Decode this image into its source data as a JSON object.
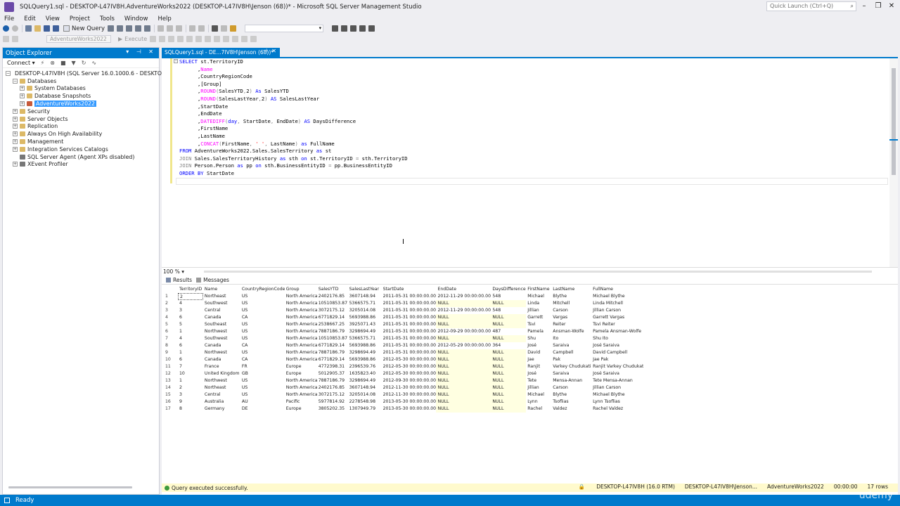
{
  "window": {
    "title": "SQLQuery1.sql - DESKTOP-L47IV8H.AdventureWorks2022 (DESKTOP-L47IV8H\\Jenson (68))* - Microsoft SQL Server Management Studio",
    "quick_launch_placeholder": "Quick Launch (Ctrl+Q)"
  },
  "menu": [
    "File",
    "Edit",
    "View",
    "Project",
    "Tools",
    "Window",
    "Help"
  ],
  "toolbar": {
    "new_query_label": "New Query",
    "database_combo_value": "AdventureWorks2022",
    "execute_label": "Execute"
  },
  "object_explorer": {
    "title": "Object Explorer",
    "connect_label": "Connect",
    "tree": {
      "server": "DESKTOP-L47IV8H (SQL Server 16.0.1000.6 - DESKTOP-L47I",
      "databases": "Databases",
      "system_databases": "System Databases",
      "database_snapshots": "Database Snapshots",
      "adventureworks": "AdventureWorks2022",
      "security": "Security",
      "server_objects": "Server Objects",
      "replication": "Replication",
      "always_on": "Always On High Availability",
      "management": "Management",
      "integration_services": "Integration Services Catalogs",
      "sql_agent": "SQL Server Agent (Agent XPs disabled)",
      "xevent": "XEvent Profiler"
    }
  },
  "document_tab": {
    "label": "SQLQuery1.sql - DE...7IV8H\\Jenson (68))*"
  },
  "editor": {
    "zoom": "100 %",
    "lines": [
      [
        {
          "t": "kw",
          "v": "SELECT"
        },
        {
          "t": "tx",
          "v": " st.TerritoryID"
        }
      ],
      [
        {
          "t": "tx",
          "v": "      ,"
        },
        {
          "t": "fn",
          "v": "Name"
        }
      ],
      [
        {
          "t": "tx",
          "v": "      ,CountryRegionCode"
        }
      ],
      [
        {
          "t": "tx",
          "v": "      ,[Group]"
        }
      ],
      [
        {
          "t": "tx",
          "v": "      ,"
        },
        {
          "t": "fn",
          "v": "ROUND"
        },
        {
          "t": "gr",
          "v": "("
        },
        {
          "t": "tx",
          "v": "SalesYTD"
        },
        {
          "t": "gr",
          "v": ","
        },
        {
          "t": "tx",
          "v": "2"
        },
        {
          "t": "gr",
          "v": ")"
        },
        {
          "t": "tx",
          "v": " "
        },
        {
          "t": "kw",
          "v": "As"
        },
        {
          "t": "tx",
          "v": " SalesYTD"
        }
      ],
      [
        {
          "t": "tx",
          "v": "      ,"
        },
        {
          "t": "fn",
          "v": "ROUND"
        },
        {
          "t": "gr",
          "v": "("
        },
        {
          "t": "tx",
          "v": "SalesLastYear"
        },
        {
          "t": "gr",
          "v": ","
        },
        {
          "t": "tx",
          "v": "2"
        },
        {
          "t": "gr",
          "v": ")"
        },
        {
          "t": "tx",
          "v": " "
        },
        {
          "t": "kw",
          "v": "AS"
        },
        {
          "t": "tx",
          "v": " SalesLastYear"
        }
      ],
      [
        {
          "t": "tx",
          "v": "      ,StartDate"
        }
      ],
      [
        {
          "t": "tx",
          "v": "      ,EndDate"
        }
      ],
      [
        {
          "t": "tx",
          "v": "      ,"
        },
        {
          "t": "fn",
          "v": "DATEDIFF"
        },
        {
          "t": "gr",
          "v": "("
        },
        {
          "t": "kw",
          "v": "day"
        },
        {
          "t": "gr",
          "v": ","
        },
        {
          "t": "tx",
          "v": " StartDate"
        },
        {
          "t": "gr",
          "v": ","
        },
        {
          "t": "tx",
          "v": " EndDate"
        },
        {
          "t": "gr",
          "v": ")"
        },
        {
          "t": "tx",
          "v": " "
        },
        {
          "t": "kw",
          "v": "AS"
        },
        {
          "t": "tx",
          "v": " DaysDifference"
        }
      ],
      [
        {
          "t": "tx",
          "v": "      ,FirstName"
        }
      ],
      [
        {
          "t": "tx",
          "v": "      ,LastName"
        }
      ],
      [
        {
          "t": "tx",
          "v": "      ,"
        },
        {
          "t": "fn",
          "v": "CONCAT"
        },
        {
          "t": "gr",
          "v": "("
        },
        {
          "t": "tx",
          "v": "FirstName"
        },
        {
          "t": "gr",
          "v": ","
        },
        {
          "t": "tx",
          "v": " "
        },
        {
          "t": "str",
          "v": "' '"
        },
        {
          "t": "gr",
          "v": ","
        },
        {
          "t": "tx",
          "v": " LastName"
        },
        {
          "t": "gr",
          "v": ")"
        },
        {
          "t": "tx",
          "v": " "
        },
        {
          "t": "kw",
          "v": "as"
        },
        {
          "t": "tx",
          "v": " FullName"
        }
      ],
      [
        {
          "t": "kw",
          "v": "FROM"
        },
        {
          "t": "tx",
          "v": " AdventureWorks2022.Sales.SalesTerritory "
        },
        {
          "t": "kw",
          "v": "as"
        },
        {
          "t": "tx",
          "v": " st"
        }
      ],
      [
        {
          "t": "gr",
          "v": "JOIN"
        },
        {
          "t": "tx",
          "v": " Sales.SalesTerritoryHistory "
        },
        {
          "t": "kw",
          "v": "as"
        },
        {
          "t": "tx",
          "v": " sth "
        },
        {
          "t": "kw",
          "v": "on"
        },
        {
          "t": "tx",
          "v": " st.TerritoryID "
        },
        {
          "t": "gr",
          "v": "="
        },
        {
          "t": "tx",
          "v": " sth.TerritoryID"
        }
      ],
      [
        {
          "t": "gr",
          "v": "JOIN"
        },
        {
          "t": "tx",
          "v": " Person.Person "
        },
        {
          "t": "kw",
          "v": "as"
        },
        {
          "t": "tx",
          "v": " pp "
        },
        {
          "t": "kw",
          "v": "on"
        },
        {
          "t": "tx",
          "v": " sth.BusinessEntityID "
        },
        {
          "t": "gr",
          "v": "="
        },
        {
          "t": "tx",
          "v": " pp.BusinessEntityID"
        }
      ],
      [
        {
          "t": "kw",
          "v": "ORDER BY"
        },
        {
          "t": "tx",
          "v": " StartDate"
        }
      ]
    ]
  },
  "results": {
    "tab_results": "Results",
    "tab_messages": "Messages",
    "columns": [
      "",
      "TerritoryID",
      "Name",
      "CountryRegionCode",
      "Group",
      "SalesYTD",
      "SalesLastYear",
      "StartDate",
      "EndDate",
      "DaysDifference",
      "FirstName",
      "LastName",
      "FullName"
    ],
    "rows": [
      [
        "1",
        "2",
        "Northeast",
        "US",
        "North America",
        "2402176.85",
        "3607148.94",
        "2011-05-31 00:00:00.000",
        "2012-11-29 00:00:00.000",
        "548",
        "Michael",
        "Blythe",
        "Michael Blythe"
      ],
      [
        "2",
        "4",
        "Southwest",
        "US",
        "North America",
        "10510853.87",
        "5366575.71",
        "2011-05-31 00:00:00.000",
        "NULL",
        "NULL",
        "Linda",
        "Mitchell",
        "Linda Mitchell"
      ],
      [
        "3",
        "3",
        "Central",
        "US",
        "North America",
        "3072175.12",
        "3205014.08",
        "2011-05-31 00:00:00.000",
        "2012-11-29 00:00:00.000",
        "548",
        "Jillian",
        "Carson",
        "Jillian Carson"
      ],
      [
        "4",
        "6",
        "Canada",
        "CA",
        "North America",
        "6771829.14",
        "5693988.86",
        "2011-05-31 00:00:00.000",
        "NULL",
        "NULL",
        "Garrett",
        "Vargas",
        "Garrett Vargas"
      ],
      [
        "5",
        "5",
        "Southeast",
        "US",
        "North America",
        "2538667.25",
        "3925071.43",
        "2011-05-31 00:00:00.000",
        "NULL",
        "NULL",
        "Tsvi",
        "Reiter",
        "Tsvi Reiter"
      ],
      [
        "6",
        "1",
        "Northwest",
        "US",
        "North America",
        "7887186.79",
        "3298694.49",
        "2011-05-31 00:00:00.000",
        "2012-09-29 00:00:00.000",
        "487",
        "Pamela",
        "Ansman-Wolfe",
        "Pamela Ansman-Wolfe"
      ],
      [
        "7",
        "4",
        "Southwest",
        "US",
        "North America",
        "10510853.87",
        "5366575.71",
        "2011-05-31 00:00:00.000",
        "NULL",
        "NULL",
        "Shu",
        "Ito",
        "Shu Ito"
      ],
      [
        "8",
        "6",
        "Canada",
        "CA",
        "North America",
        "6771829.14",
        "5693988.86",
        "2011-05-31 00:00:00.000",
        "2012-05-29 00:00:00.000",
        "364",
        "José",
        "Saraiva",
        "José Saraiva"
      ],
      [
        "9",
        "1",
        "Northwest",
        "US",
        "North America",
        "7887186.79",
        "3298694.49",
        "2011-05-31 00:00:00.000",
        "NULL",
        "NULL",
        "David",
        "Campbell",
        "David Campbell"
      ],
      [
        "10",
        "6",
        "Canada",
        "CA",
        "North America",
        "6771829.14",
        "5693988.86",
        "2012-05-30 00:00:00.000",
        "NULL",
        "NULL",
        "Jae",
        "Pak",
        "Jae Pak"
      ],
      [
        "11",
        "7",
        "France",
        "FR",
        "Europe",
        "4772398.31",
        "2396539.76",
        "2012-05-30 00:00:00.000",
        "NULL",
        "NULL",
        "Ranjit",
        "Varkey Chudukatil",
        "Ranjit Varkey Chudukatil"
      ],
      [
        "12",
        "10",
        "United Kingdom",
        "GB",
        "Europe",
        "5012905.37",
        "1635823.40",
        "2012-05-30 00:00:00.000",
        "NULL",
        "NULL",
        "José",
        "Saraiva",
        "José Saraiva"
      ],
      [
        "13",
        "1",
        "Northwest",
        "US",
        "North America",
        "7887186.79",
        "3298694.49",
        "2012-09-30 00:00:00.000",
        "NULL",
        "NULL",
        "Tete",
        "Mensa-Annan",
        "Tete Mensa-Annan"
      ],
      [
        "14",
        "2",
        "Northeast",
        "US",
        "North America",
        "2402176.85",
        "3607148.94",
        "2012-11-30 00:00:00.000",
        "NULL",
        "NULL",
        "Jillian",
        "Carson",
        "Jillian Carson"
      ],
      [
        "15",
        "3",
        "Central",
        "US",
        "North America",
        "3072175.12",
        "3205014.08",
        "2012-11-30 00:00:00.000",
        "NULL",
        "NULL",
        "Michael",
        "Blythe",
        "Michael Blythe"
      ],
      [
        "16",
        "9",
        "Australia",
        "AU",
        "Pacific",
        "5977814.92",
        "2278548.98",
        "2013-05-30 00:00:00.000",
        "NULL",
        "NULL",
        "Lynn",
        "Tsoflias",
        "Lynn Tsoflias"
      ],
      [
        "17",
        "8",
        "Germany",
        "DE",
        "Europe",
        "3805202.35",
        "1307949.79",
        "2013-05-30 00:00:00.000",
        "NULL",
        "NULL",
        "Rachel",
        "Valdez",
        "Rachel Valdez"
      ]
    ]
  },
  "query_status": {
    "message": "Query executed successfully.",
    "server": "DESKTOP-L47IV8H (16.0 RTM)",
    "user": "DESKTOP-L47IV8H\\Jenson...",
    "database": "AdventureWorks2022",
    "elapsed": "00:00:00",
    "rows": "17 rows"
  },
  "status_bar": {
    "text": "Ready"
  },
  "watermark": "udemy",
  "colors": {
    "accent": "#007acc",
    "keyword": "#0000ff",
    "function": "#ff00ff",
    "string": "#ff0000",
    "operator": "#808080",
    "null_cell": "#ffffe1"
  }
}
